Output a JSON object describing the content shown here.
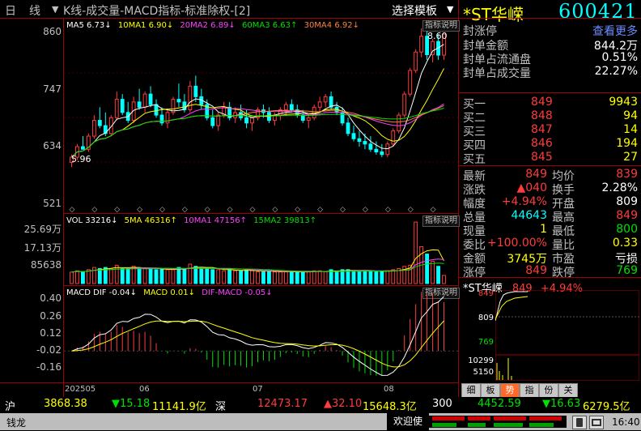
{
  "header": {
    "period": "日",
    "period2": "线",
    "arrow": "▼",
    "chart_title": "K线-成交量-MACD指标-标准除权-[2]",
    "template_button": "选择模板",
    "template_arrow": "▼",
    "stock_name": "*ST华嵘",
    "stock_code": "600421"
  },
  "price_panel": {
    "legend": [
      {
        "label": "MA5 6.73↓",
        "color": "#ffffff"
      },
      {
        "label": "10MA1 6.90↓",
        "color": "#ffff00"
      },
      {
        "label": "20MA2 6.89↓",
        "color": "#ff40ff"
      },
      {
        "label": "60MA3 6.63↑",
        "color": "#00e000"
      },
      {
        "label": "30MA4 6.92↓",
        "color": "#ff8040"
      }
    ],
    "indicator_button": "指标说明",
    "yticks": [
      "860",
      "747",
      "634",
      "521"
    ],
    "max_label": "8.60",
    "min_label": "5.96"
  },
  "volume_panel": {
    "legend": [
      {
        "label": "VOL 33216↓",
        "color": "#ffffff"
      },
      {
        "label": "5MA 46316↑",
        "color": "#ffff00"
      },
      {
        "label": "10MA1 47156↑",
        "color": "#ff40ff"
      },
      {
        "label": "15MA2 39813↑",
        "color": "#00e000"
      }
    ],
    "indicator_button": "指标说明",
    "yticks": [
      "25.69万",
      "17.13万",
      "85638"
    ]
  },
  "macd_panel": {
    "legend": [
      {
        "label": "MACD DIF -0.04↓",
        "color": "#ffffff"
      },
      {
        "label": "MACD 0.01↓",
        "color": "#ffff00"
      },
      {
        "label": "DIF-MACD -0.05↓",
        "color": "#ff40ff"
      }
    ],
    "indicator_button": "指标说明",
    "yticks": [
      "0.40",
      "0.26",
      "0.12",
      "-0.02",
      "-0.16"
    ]
  },
  "x_axis": {
    "labels": [
      "202505",
      "06",
      "07",
      "08"
    ]
  },
  "right_panel": {
    "top_rows": [
      {
        "label": "封涨停",
        "value": "查看更多",
        "vcolor": "#6b8cff"
      },
      {
        "label": "封单金额",
        "value": "844.2万",
        "vcolor": "#ffffff"
      },
      {
        "label": "封单占流通盘",
        "value": "0.51%",
        "vcolor": "#ffffff"
      },
      {
        "label": "封单占成交量",
        "value": "22.27%",
        "vcolor": "#ffffff"
      }
    ],
    "asks": [
      {
        "label": "买一",
        "price": "849",
        "vol": "9943"
      },
      {
        "label": "买二",
        "price": "848",
        "vol": "94"
      },
      {
        "label": "买三",
        "price": "847",
        "vol": "14"
      },
      {
        "label": "买四",
        "price": "846",
        "vol": "194"
      },
      {
        "label": "买五",
        "price": "845",
        "vol": "27"
      }
    ],
    "stats": [
      {
        "l1": "最新",
        "v1": "849",
        "c1": "#ff3c3c",
        "l2": "均价",
        "v2": "839",
        "c2": "#ff3c3c"
      },
      {
        "l1": "涨跌",
        "v1": "▲040",
        "c1": "#ff3c3c",
        "l2": "换手",
        "v2": "2.28%",
        "c2": "#ffffff"
      },
      {
        "l1": "幅度",
        "v1": "+4.94%",
        "c1": "#ff3c3c",
        "l2": "开盘",
        "v2": "809",
        "c2": "#ffffff"
      },
      {
        "l1": "总量",
        "v1": "44643",
        "c1": "#00ffff",
        "l2": "最高",
        "v2": "849",
        "c2": "#ff3c3c"
      },
      {
        "l1": "现量",
        "v1": "1",
        "c1": "#ffff00",
        "l2": "最低",
        "v2": "800",
        "c2": "#00e000"
      },
      {
        "l1": "委比",
        "v1": "+100.00%",
        "c1": "#ff3c3c",
        "l2": "量比",
        "v2": "0.33",
        "c2": "#ffff00"
      },
      {
        "l1": "金额",
        "v1": "3745万",
        "c1": "#ffff00",
        "l2": "市盈",
        "v2": "亏损",
        "c2": "#ffffff"
      },
      {
        "l1": "涨停",
        "v1": "849",
        "c1": "#ff3c3c",
        "l2": "跌停",
        "v2": "769",
        "c2": "#00e000"
      }
    ],
    "mini_chart": {
      "name": "*ST华嵘",
      "price": "849",
      "change": "+4.94%",
      "yticks": [
        "849",
        "809",
        "769"
      ],
      "vol_ticks": [
        "10299",
        "5150"
      ]
    },
    "tabs": [
      "细",
      "板",
      "势",
      "指",
      "份",
      "关"
    ],
    "active_tab": 2
  },
  "bottom_bar": {
    "sh_label": "沪",
    "sh_index": "3868.38",
    "sh_change": "▼15.18",
    "sh_amount": "11141.9亿",
    "sz_label": "深",
    "sz_index": "12473.17",
    "sz_change": "▲32.10",
    "sz_amount": "15648.3亿",
    "cy_label": "300",
    "cy_index": "4452.59",
    "cy_change": "▼16.63",
    "cy_amount": "6279.5亿"
  },
  "status_bar": {
    "app_name": "钱龙",
    "welcome": "欢迎使",
    "time": "16:40"
  },
  "chart_data": {
    "type": "candlestick",
    "x_labels": [
      "202505",
      "06",
      "07",
      "08"
    ],
    "price_ylim": [
      5.21,
      8.6
    ],
    "candles": [
      [
        6.05,
        6.2,
        5.96,
        6.15
      ],
      [
        6.15,
        6.4,
        6.1,
        6.35
      ],
      [
        6.35,
        6.55,
        6.3,
        6.3
      ],
      [
        6.3,
        6.6,
        6.25,
        6.55
      ],
      [
        6.55,
        6.95,
        6.5,
        6.85
      ],
      [
        6.85,
        7.1,
        6.7,
        6.75
      ],
      [
        6.75,
        7.0,
        6.55,
        6.6
      ],
      [
        6.6,
        6.95,
        6.55,
        6.9
      ],
      [
        6.9,
        7.4,
        6.85,
        7.25
      ],
      [
        7.25,
        7.35,
        6.95,
        7.0
      ],
      [
        7.0,
        7.2,
        6.8,
        6.85
      ],
      [
        6.85,
        7.3,
        6.8,
        7.2
      ],
      [
        7.2,
        7.45,
        7.05,
        7.1
      ],
      [
        7.1,
        7.4,
        7.0,
        7.35
      ],
      [
        7.35,
        7.5,
        7.1,
        7.15
      ],
      [
        7.15,
        7.25,
        6.9,
        6.95
      ],
      [
        6.95,
        7.1,
        6.75,
        6.8
      ],
      [
        6.8,
        7.05,
        6.7,
        7.0
      ],
      [
        7.0,
        7.3,
        6.95,
        7.25
      ],
      [
        7.25,
        7.55,
        7.1,
        7.2
      ],
      [
        7.2,
        7.35,
        7.0,
        7.05
      ],
      [
        7.05,
        7.6,
        7.0,
        7.5
      ],
      [
        7.5,
        7.7,
        7.2,
        7.3
      ],
      [
        7.3,
        7.45,
        7.05,
        7.15
      ],
      [
        7.15,
        7.25,
        6.85,
        6.9
      ],
      [
        6.9,
        7.05,
        6.7,
        6.75
      ],
      [
        6.75,
        7.0,
        6.65,
        6.95
      ],
      [
        6.95,
        7.2,
        6.9,
        7.1
      ],
      [
        7.1,
        7.2,
        6.85,
        6.9
      ],
      [
        6.9,
        7.1,
        6.8,
        7.0
      ],
      [
        7.0,
        7.15,
        6.85,
        6.9
      ],
      [
        6.9,
        7.05,
        6.7,
        6.8
      ],
      [
        6.8,
        6.95,
        6.65,
        6.9
      ],
      [
        6.9,
        7.1,
        6.85,
        7.05
      ],
      [
        7.05,
        7.15,
        6.9,
        7.0
      ],
      [
        7.0,
        7.1,
        6.8,
        6.85
      ],
      [
        6.85,
        7.0,
        6.75,
        6.95
      ],
      [
        6.95,
        7.1,
        6.85,
        7.05
      ],
      [
        7.05,
        7.2,
        6.95,
        7.15
      ],
      [
        7.15,
        7.25,
        7.0,
        7.05
      ],
      [
        7.05,
        7.15,
        6.9,
        6.95
      ],
      [
        6.95,
        7.05,
        6.8,
        6.85
      ],
      [
        6.85,
        6.95,
        6.7,
        6.9
      ],
      [
        6.9,
        7.15,
        6.85,
        7.1
      ],
      [
        7.1,
        7.3,
        7.0,
        7.2
      ],
      [
        7.2,
        7.35,
        7.1,
        7.3
      ],
      [
        7.3,
        7.4,
        7.05,
        7.1
      ],
      [
        7.1,
        7.2,
        6.95,
        7.0
      ],
      [
        7.0,
        7.1,
        6.75,
        6.8
      ],
      [
        6.8,
        6.9,
        6.55,
        6.6
      ],
      [
        6.6,
        6.75,
        6.45,
        6.5
      ],
      [
        6.5,
        6.65,
        6.35,
        6.45
      ],
      [
        6.45,
        6.6,
        6.3,
        6.4
      ],
      [
        6.4,
        6.55,
        6.25,
        6.3
      ],
      [
        6.3,
        6.45,
        6.2,
        6.25
      ],
      [
        6.25,
        6.4,
        6.15,
        6.2
      ],
      [
        6.2,
        6.45,
        6.15,
        6.4
      ],
      [
        6.4,
        6.7,
        6.35,
        6.65
      ],
      [
        6.65,
        7.0,
        6.6,
        6.95
      ],
      [
        6.95,
        7.4,
        6.9,
        7.35
      ],
      [
        7.35,
        7.85,
        7.3,
        7.8
      ],
      [
        7.8,
        8.2,
        7.75,
        8.15
      ],
      [
        8.15,
        8.6,
        8.05,
        8.45
      ],
      [
        8.45,
        8.55,
        8.0,
        8.1
      ],
      [
        8.1,
        8.4,
        7.95,
        8.35
      ],
      [
        8.35,
        8.49,
        8.0,
        8.09
      ],
      [
        8.09,
        8.49,
        8.0,
        8.49
      ]
    ]
  }
}
